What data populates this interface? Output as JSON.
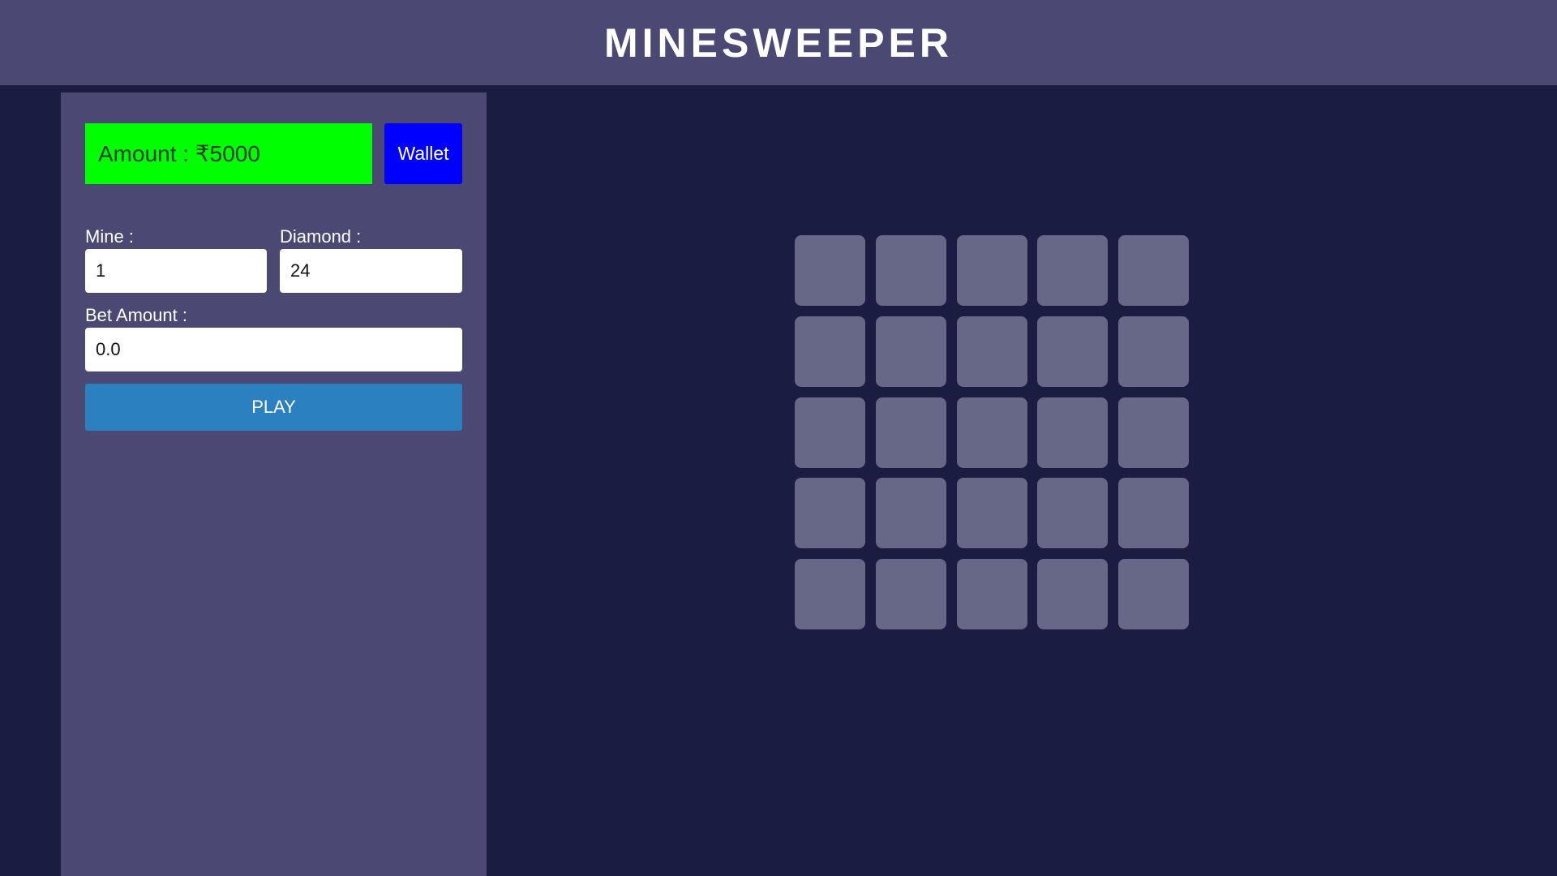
{
  "header": {
    "title": "MINESWEEPER"
  },
  "sidebar": {
    "amount_text": "Amount : ₹5000",
    "wallet_label": "Wallet",
    "mine_label": "Mine :",
    "mine_value": "1",
    "diamond_label": "Diamond :",
    "diamond_value": "24",
    "bet_label": "Bet Amount :",
    "bet_value": "0.0",
    "play_label": "PLAY"
  },
  "board": {
    "rows": 5,
    "cols": 5,
    "tiles_revealed": 0
  },
  "colors": {
    "background": "#1b1c42",
    "panel": "#4b4873",
    "amount_bg": "#00ff00",
    "wallet_bg": "#0000ff",
    "play_bg": "#2b80bf",
    "tile": "#676887"
  }
}
